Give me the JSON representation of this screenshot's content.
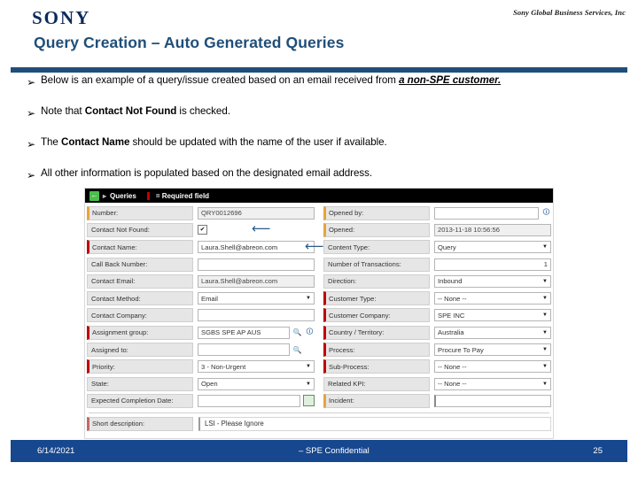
{
  "header": {
    "logo": "SONY",
    "corporate_line": "Sony Global Business Services, Inc",
    "title": "Query Creation – Auto Generated Queries"
  },
  "bullets": [
    {
      "marker": "➢",
      "pre": "Below is an example of a query/issue created based on an email received from ",
      "emph": "a non-SPE customer.",
      "post": ""
    },
    {
      "marker": "➢",
      "pre": "Note that ",
      "bold": "Contact Not Found",
      "post": " is checked."
    },
    {
      "marker": "➢",
      "pre": "The ",
      "bold": "Contact Name",
      "post": " should be updated with the name of the user if available."
    },
    {
      "marker": "➢",
      "pre": "All other information is populated based on the designated email address.",
      "bold": "",
      "post": ""
    }
  ],
  "screenshot": {
    "titlebar": {
      "back_icon": "back-arrow-icon",
      "breadcrumb": "Queries",
      "required_legend": "= Required field"
    },
    "left_fields": [
      {
        "label": "Number:",
        "required": "orange",
        "type": "text-readonly",
        "value": "QRY0012696"
      },
      {
        "label": "Contact Not Found:",
        "required": "none",
        "type": "checkbox",
        "value": "✔",
        "arrow": "left-arrow-annotation"
      },
      {
        "label": "Contact Name:",
        "required": "red",
        "type": "text",
        "value": "Laura.Shell@abreon.com",
        "arrow": "left-arrow-annotation"
      },
      {
        "label": "Call Back Number:",
        "required": "none",
        "type": "text",
        "value": ""
      },
      {
        "label": "Contact Email:",
        "required": "none",
        "type": "text-readonly",
        "value": "Laura.Shell@abreon.com"
      },
      {
        "label": "Contact Method:",
        "required": "none",
        "type": "select",
        "value": "Email"
      },
      {
        "label": "Contact Company:",
        "required": "none",
        "type": "text",
        "value": ""
      },
      {
        "label": "Assignment group:",
        "required": "red",
        "type": "text-lookup",
        "value": "SGBS SPE AP AUS",
        "icons": [
          "magnifier-icon",
          "reference-icon"
        ]
      },
      {
        "label": "Assigned to:",
        "required": "none",
        "type": "text-lookup",
        "value": "",
        "icons": [
          "magnifier-icon"
        ]
      },
      {
        "label": "Priority:",
        "required": "red",
        "type": "select",
        "value": "3 - Non-Urgent"
      },
      {
        "label": "State:",
        "required": "none",
        "type": "select",
        "value": "Open"
      },
      {
        "label": "Expected Completion Date:",
        "required": "none",
        "type": "text-date",
        "value": "",
        "icons": [
          "calendar-icon"
        ]
      }
    ],
    "right_fields": [
      {
        "label": "Opened by:",
        "required": "orange",
        "type": "text-lookup",
        "value": "",
        "icons": [
          "reference-icon"
        ]
      },
      {
        "label": "Opened:",
        "required": "orange",
        "type": "text-readonly",
        "value": "2013-11-18 10:56:56"
      },
      {
        "label": "Content Type:",
        "required": "none",
        "type": "select",
        "value": "Query"
      },
      {
        "label": "Number of Transactions:",
        "required": "none",
        "type": "text-number",
        "value": "1"
      },
      {
        "label": "Direction:",
        "required": "none",
        "type": "select",
        "value": "Inbound"
      },
      {
        "label": "Customer Type:",
        "required": "red",
        "type": "select",
        "value": "-- None --"
      },
      {
        "label": "Customer Company:",
        "required": "red",
        "type": "select",
        "value": "SPE INC"
      },
      {
        "label": "Country / Territory:",
        "required": "red",
        "type": "select",
        "value": "Australia"
      },
      {
        "label": "Process:",
        "required": "red",
        "type": "select",
        "value": "Procure To Pay"
      },
      {
        "label": "Sub-Process:",
        "required": "red",
        "type": "select",
        "value": "-- None --"
      },
      {
        "label": "Related KPI:",
        "required": "none",
        "type": "select",
        "value": "-- None --"
      },
      {
        "label": "Incident:",
        "required": "orange",
        "type": "text",
        "value": ""
      }
    ],
    "short_description": {
      "label": "Short description:",
      "value": "LSI - Please Ignore"
    }
  },
  "footer": {
    "date": "6/14/2021",
    "center": "– SPE Confidential",
    "page": "25"
  },
  "colors": {
    "sony_navy": "#0b2a5b",
    "title_blue": "#1F4E79",
    "footer_blue": "#17478E",
    "required_red": "#c00000",
    "required_orange": "#E8A33D",
    "arrow_blue": "#2E5C8A"
  }
}
